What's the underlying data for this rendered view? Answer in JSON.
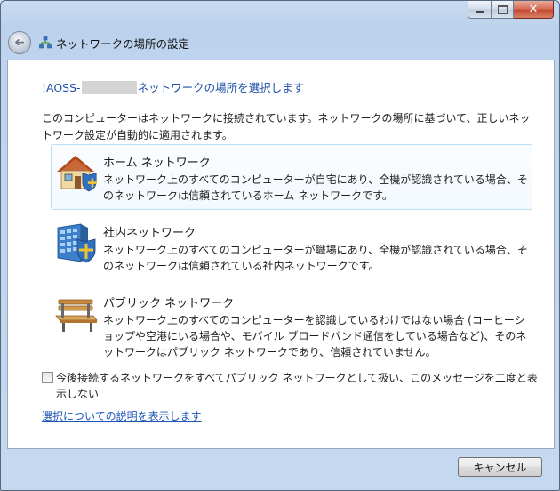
{
  "window": {
    "title": "ネットワークの場所の設定",
    "minimize_icon": "minimize-icon",
    "maximize_icon": "maximize-icon",
    "close_icon": "close-icon",
    "close_glyph": "✕",
    "back_icon": "back-arrow-icon",
    "back_glyph": "➜"
  },
  "content": {
    "heading_prefix": "!AOSS-",
    "heading_suffix": "ネットワークの場所を選択します",
    "intro": "このコンピューターはネットワークに接続されています。ネットワークの場所に基づいて、正しいネットワーク設定が自動的に適用されます。",
    "options": [
      {
        "title": "ホーム ネットワーク",
        "description": "ネットワーク上のすべてのコンピューターが自宅にあり、全機が認識されている場合、そのネットワークは信頼されているホーム ネットワークです。",
        "icon": "home-shield-icon",
        "selected": true
      },
      {
        "title": "社内ネットワーク",
        "description": "ネットワーク上のすべてのコンピューターが職場にあり、全機が認識されている場合、そのネットワークは信頼されている社内ネットワークです。",
        "icon": "office-building-shield-icon",
        "selected": false
      },
      {
        "title": "パブリック ネットワーク",
        "description": "ネットワーク上のすべてのコンピューターを認識しているわけではない場合 (コーヒーショップや空港にいる場合や、モバイル ブロードバンド通信をしている場合など)、そのネットワークはパブリック ネットワークであり、信頼されていません。",
        "icon": "park-bench-icon",
        "selected": false
      }
    ],
    "checkbox_label": "今後接続するネットワークをすべてパブリック ネットワークとして扱い、このメッセージを二度と表示しない",
    "checkbox_checked": false,
    "help_link": "選択についての説明を表示します"
  },
  "footer": {
    "cancel_label": "キャンセル"
  },
  "colors": {
    "heading": "#1d4fa8",
    "link": "#1c56b8",
    "selected_border": "#b9def5"
  }
}
